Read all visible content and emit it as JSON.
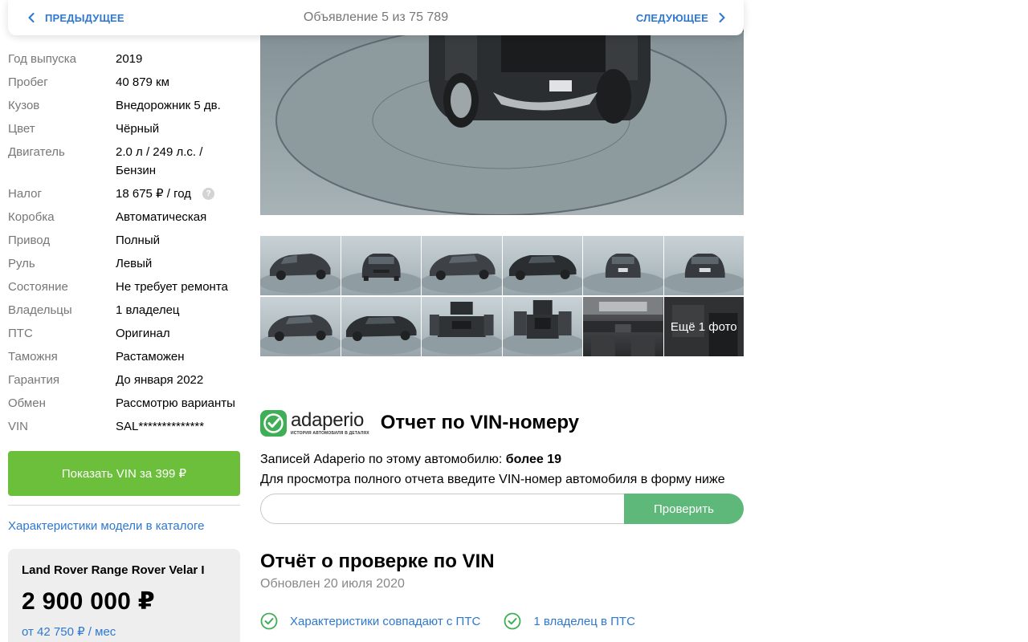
{
  "nav": {
    "prev_label": "ПРЕДЫДУЩЕЕ",
    "counter": "Объявление 5 из 75 789",
    "next_label": "СЛЕДУЮЩЕЕ"
  },
  "specs": [
    {
      "label": "Год выпуска",
      "value": "2019"
    },
    {
      "label": "Пробег",
      "value": "40 879 км"
    },
    {
      "label": "Кузов",
      "value": "Внедорожник 5 дв."
    },
    {
      "label": "Цвет",
      "value": "Чёрный"
    },
    {
      "label": "Двигатель",
      "value": "2.0 л / 249 л.с. / Бензин"
    },
    {
      "label": "Налог",
      "value": "18 675 ₽ / год"
    },
    {
      "label": "Коробка",
      "value": "Автоматическая"
    },
    {
      "label": "Привод",
      "value": "Полный"
    },
    {
      "label": "Руль",
      "value": "Левый"
    },
    {
      "label": "Состояние",
      "value": "Не требует ремонта"
    },
    {
      "label": "Владельцы",
      "value": "1 владелец"
    },
    {
      "label": "ПТС",
      "value": "Оригинал"
    },
    {
      "label": "Таможня",
      "value": "Растаможен"
    },
    {
      "label": "Гарантия",
      "value": "До января 2022"
    },
    {
      "label": "Обмен",
      "value": "Рассмотрю варианты"
    },
    {
      "label": "VIN",
      "value": "SAL**************"
    }
  ],
  "tax_help": "?",
  "vin_button": "Показать VIN за 399 ₽",
  "catalog_link": "Характеристики модели в каталоге",
  "price_card": {
    "title": "Land Rover Range Rover Velar I",
    "price": "2 900 000 ₽",
    "monthly": "от 42 750 ₽ / мес"
  },
  "gallery": {
    "more_photos": "Ещё 1 фото"
  },
  "adaperio": {
    "logo_word": "adaperio",
    "logo_sub": "ИСТОРИЯ АВТОМОБИЛЯ В ДЕТАЛЯХ",
    "title": "Отчет по VIN-номеру",
    "records_prefix": "Записей Adaperio по этому автомобилю: ",
    "records_value": "более 19",
    "description": "Для просмотра полного отчета введите VIN-номер автомобиля в форму ниже",
    "input_value": "",
    "check_button": "Проверить"
  },
  "report": {
    "title": "Отчёт о проверке по VIN",
    "updated": "Обновлен 20 июля 2020",
    "checks": [
      "Характеристики совпадают с ПТС",
      "1 владелец в ПТС"
    ]
  },
  "colors": {
    "link_blue": "#2f78d0",
    "vin_button_green": "#6bbf3b",
    "check_button_green": "#5db87a",
    "check_icon_green": "#3fae56"
  }
}
